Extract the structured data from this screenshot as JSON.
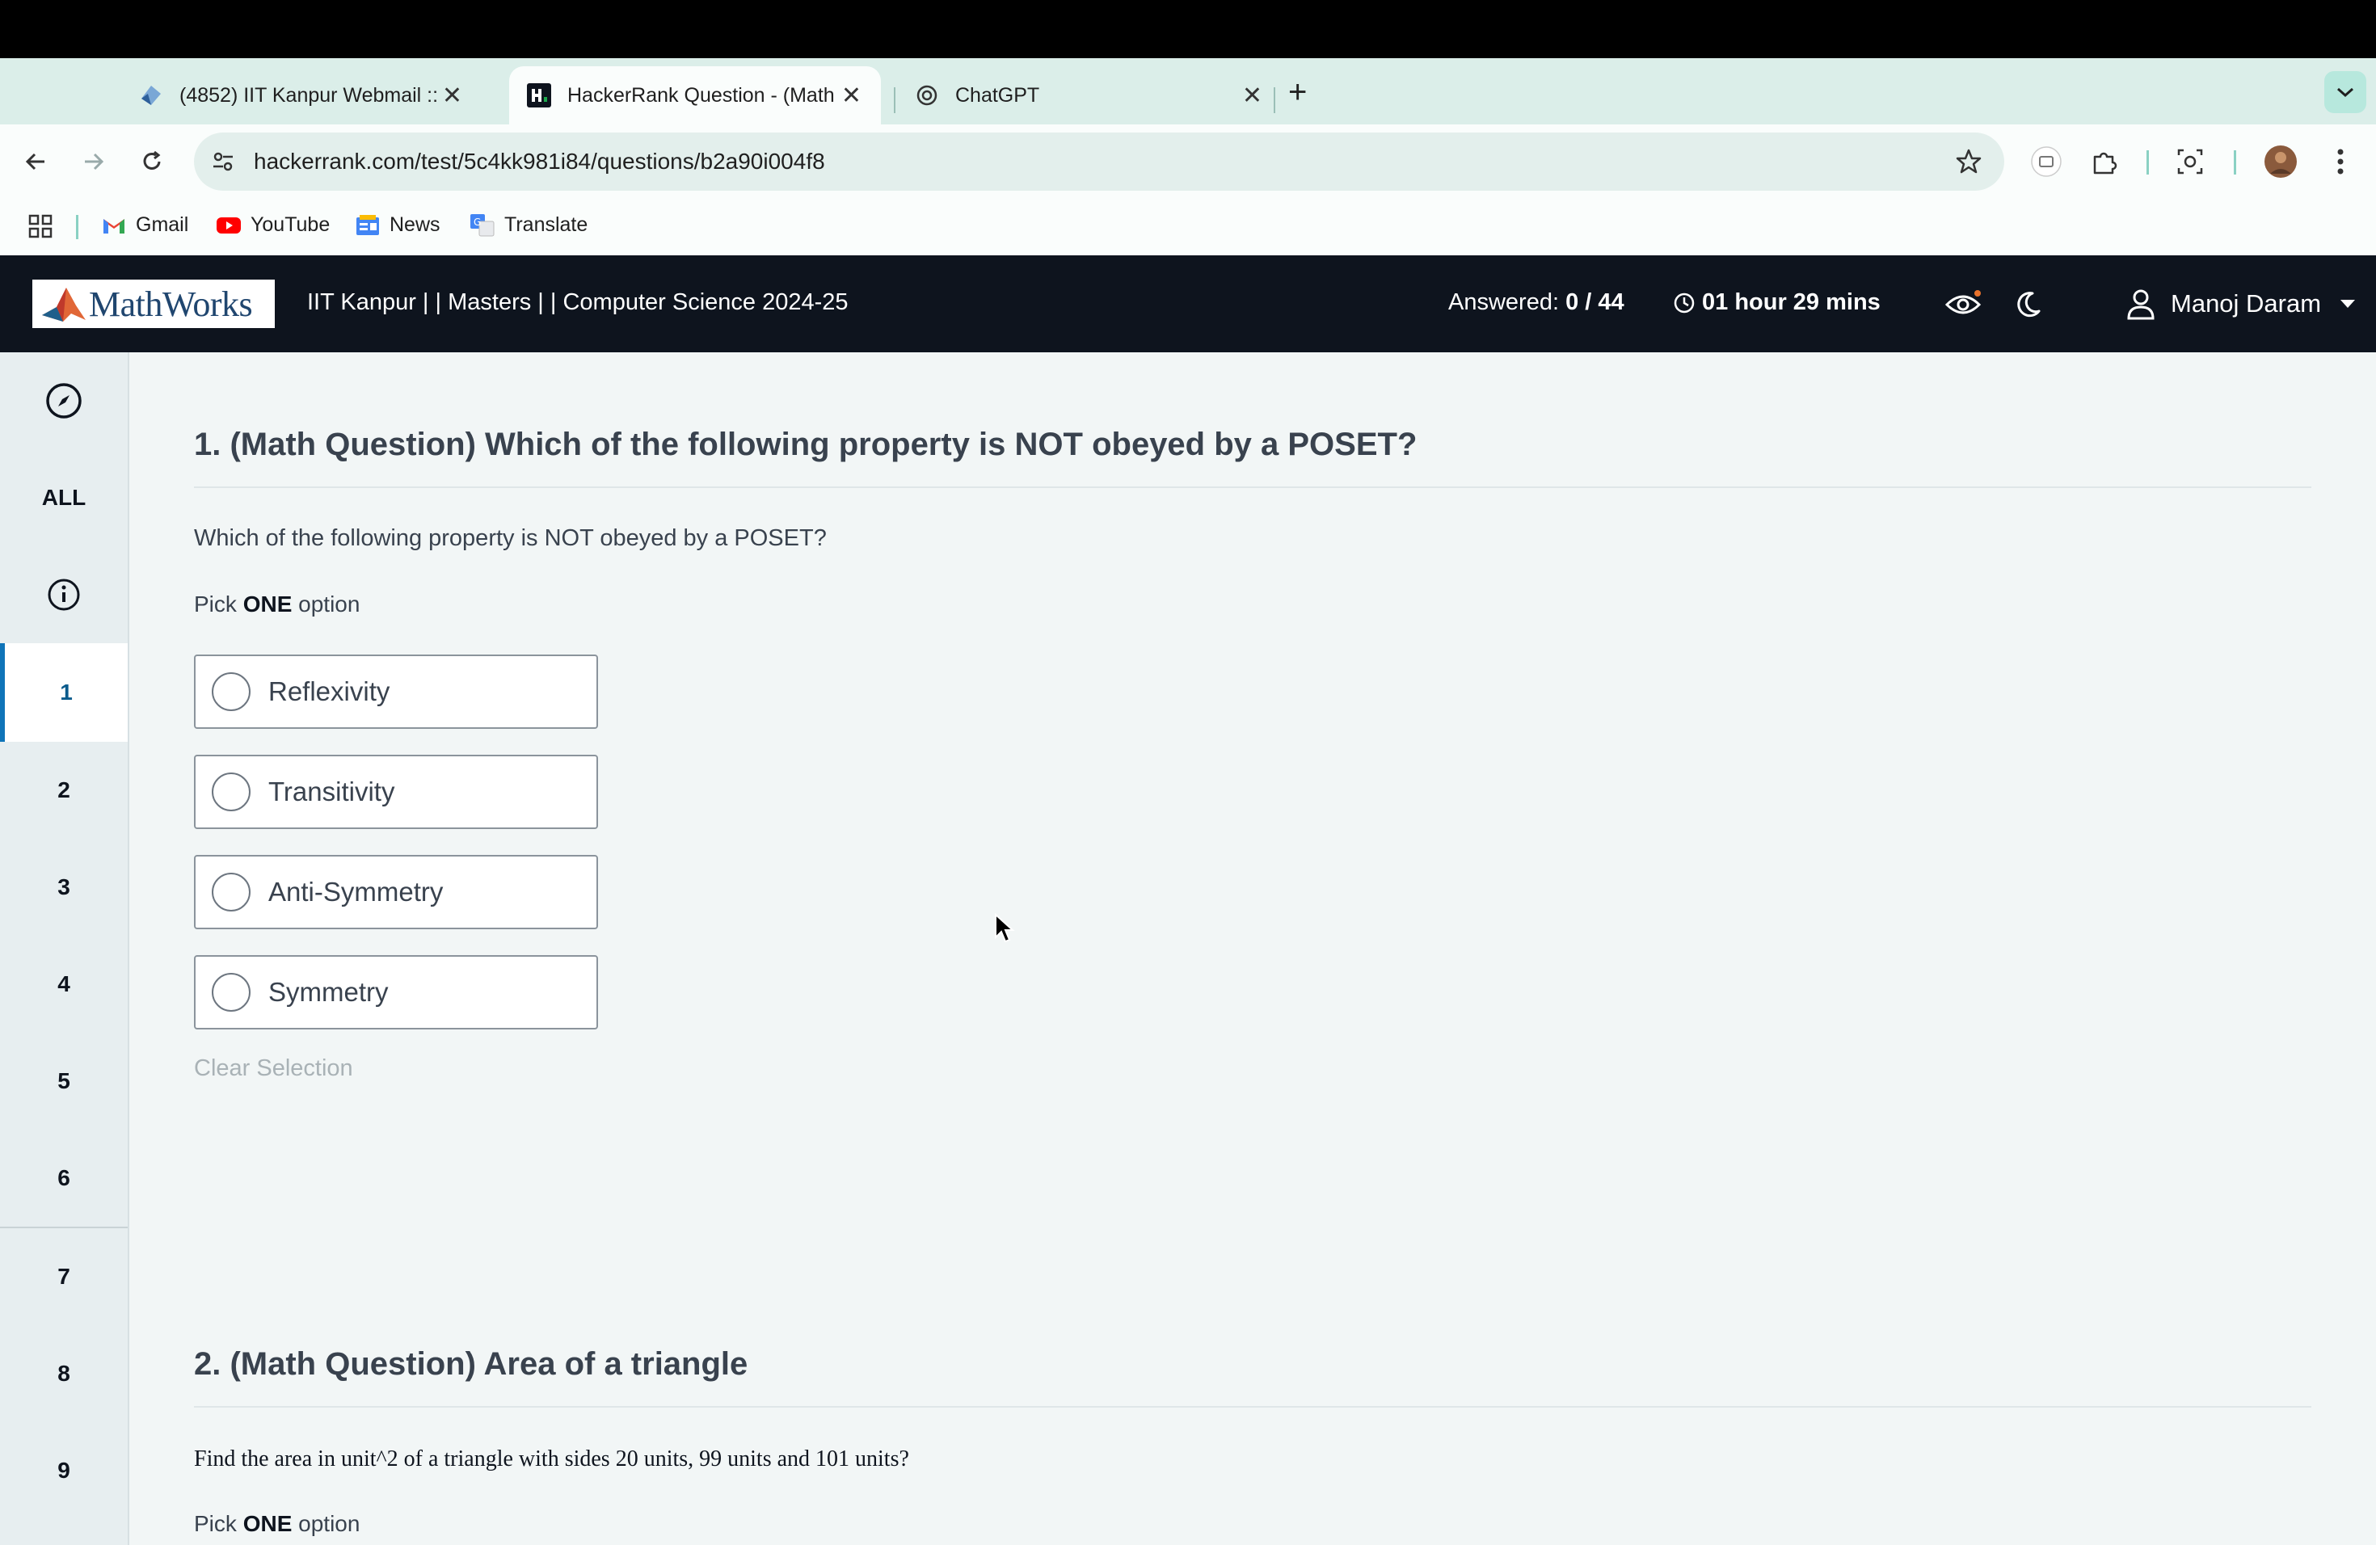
{
  "browser": {
    "tabs": [
      {
        "title": "(4852) IIT Kanpur Webmail ::",
        "icon": "webmail-icon",
        "active": false
      },
      {
        "title": "HackerRank Question - (Math",
        "icon": "hackerrank-icon",
        "active": true
      },
      {
        "title": "ChatGPT",
        "icon": "chatgpt-icon",
        "active": false
      }
    ],
    "url": "hackerrank.com/test/5c4kk981i84/questions/b2a90i004f8",
    "bookmarks": [
      "Gmail",
      "YouTube",
      "News",
      "Translate"
    ]
  },
  "header": {
    "logo_text": "MathWorks",
    "test_name": "IIT Kanpur | | Masters | | Computer Science 2024-25",
    "answered_label": "Answered:",
    "answered_value": "0 / 44",
    "timer": "01 hour 29 mins",
    "user_name": "Manoj Daram"
  },
  "sidebar": {
    "all_label": "ALL",
    "questions": [
      "1",
      "2",
      "3",
      "4",
      "5",
      "6",
      "7",
      "8",
      "9"
    ],
    "active": "1"
  },
  "question1": {
    "title": "1. (Math Question) Which of the following property is NOT obeyed by a POSET?",
    "text": "Which of the following property is NOT obeyed by a POSET?",
    "pick_prefix": "Pick",
    "pick_bold": "ONE",
    "pick_suffix": "option",
    "options": [
      "Reflexivity",
      "Transitivity",
      "Anti-Symmetry",
      "Symmetry"
    ],
    "clear_label": "Clear Selection"
  },
  "question2": {
    "title": "2. (Math Question) Area of a triangle",
    "text": "Find the area in unit^2 of a triangle with sides 20 units, 99 units and 101 units?",
    "pick_prefix": "Pick",
    "pick_bold": "ONE",
    "pick_suffix": "option"
  },
  "colors": {
    "header_bg": "#0e141e",
    "tabstrip_bg": "#dbeee9",
    "content_bg": "#f2f6f6",
    "active_question": "#0f74b8"
  }
}
